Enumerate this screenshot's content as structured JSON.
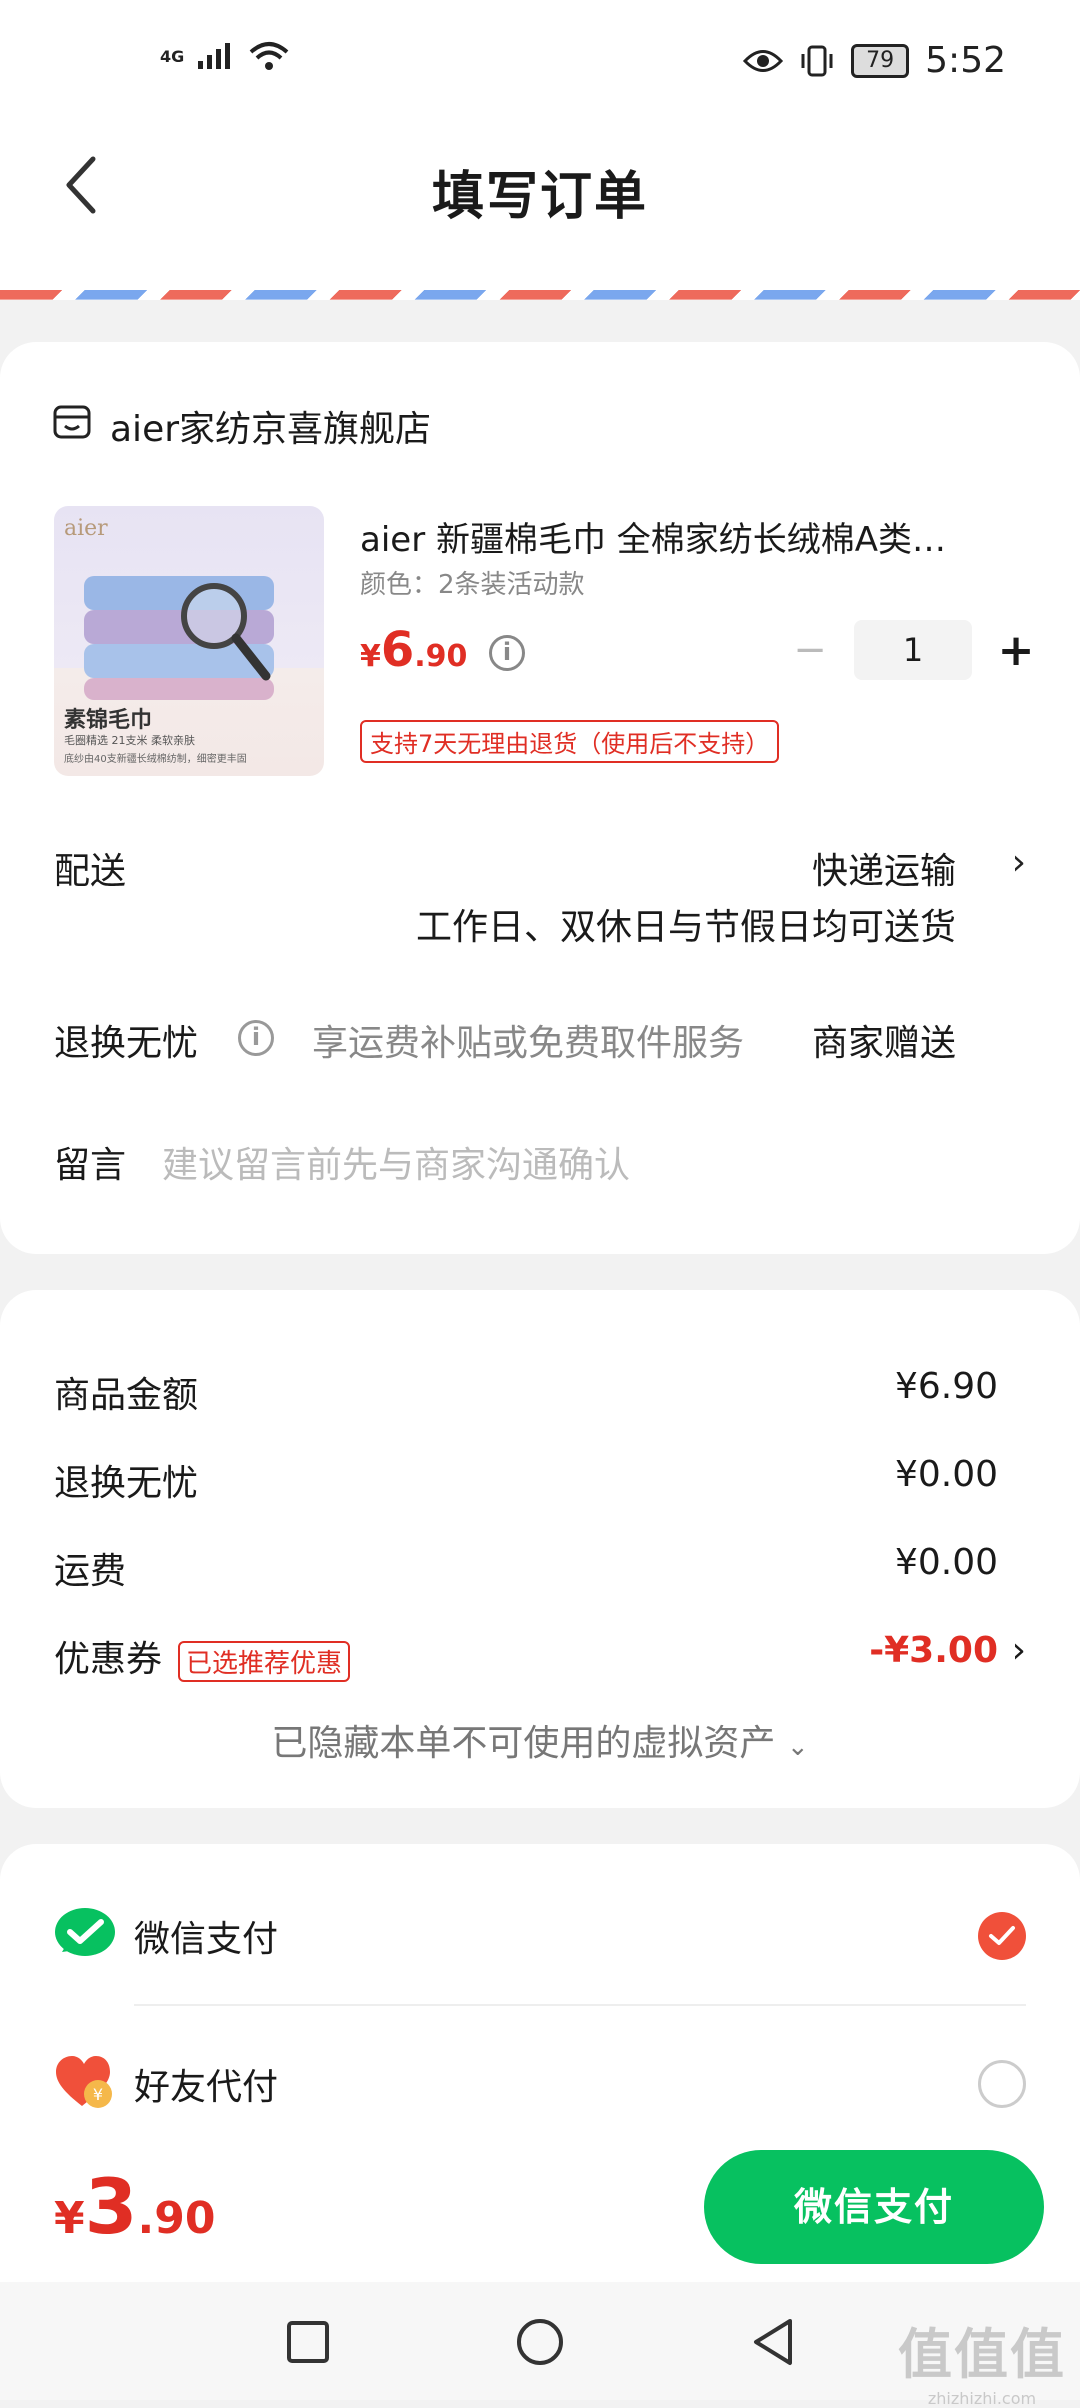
{
  "status_bar": {
    "network": "4G",
    "battery": "79",
    "time": "5:52"
  },
  "header": {
    "title": "填写订单"
  },
  "store": {
    "name": "aier家纺京喜旗舰店",
    "product": {
      "image_brand": "aier",
      "image_title": "素锦毛巾",
      "image_sub": "毛圈精选 21支米 柔软亲肤",
      "image_sub2": "底纱由40支新疆长绒棉纺制，细密更丰固",
      "title": "aier 新疆棉毛巾 全棉家纺长绒棉A类…",
      "spec": "颜色：2条装活动款",
      "price_currency": "¥",
      "price_int": "6",
      "price_dec": ".90",
      "quantity": "1",
      "return_tag": "支持7天无理由退货（使用后不支持）"
    },
    "delivery": {
      "label": "配送",
      "method": "快递运输",
      "note": "工作日、双休日与节假日均可送货"
    },
    "worry_free": {
      "label": "退换无忧",
      "desc": "享运费补贴或免费取件服务",
      "value": "商家赠送"
    },
    "message": {
      "label": "留言",
      "placeholder": "建议留言前先与商家沟通确认"
    }
  },
  "summary": {
    "rows": [
      {
        "label": "商品金额",
        "value": "¥6.90"
      },
      {
        "label": "退换无忧",
        "value": "¥0.00"
      },
      {
        "label": "运费",
        "value": "¥0.00"
      }
    ],
    "coupon": {
      "label": "优惠券",
      "tag": "已选推荐优惠",
      "value": "-¥3.00"
    },
    "hidden_assets": "已隐藏本单不可使用的虚拟资产"
  },
  "payment": {
    "methods": [
      {
        "label": "微信支付",
        "selected": true
      },
      {
        "label": "好友代付",
        "selected": false
      }
    ]
  },
  "footer": {
    "total_currency": "¥",
    "total_int": "3",
    "total_dec": ".90",
    "pay_button": "微信支付"
  },
  "watermark": {
    "big": "值值值",
    "small": "zhizhizhi.com"
  },
  "colors": {
    "accent_red": "#e02e24",
    "wechat_green": "#07c160"
  }
}
